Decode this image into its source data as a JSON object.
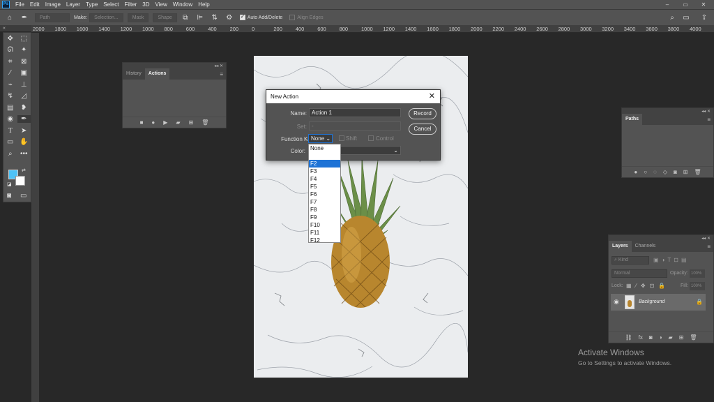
{
  "menubar": {
    "app_logo": "Ps",
    "items": [
      "File",
      "Edit",
      "Image",
      "Layer",
      "Type",
      "Select",
      "Filter",
      "3D",
      "View",
      "Window",
      "Help"
    ],
    "window_controls": [
      "–",
      "▭",
      "✕"
    ]
  },
  "options_bar": {
    "mode_value": "Path",
    "make_label": "Make:",
    "selection_button": "Selection...",
    "mask_button": "Mask",
    "shape_button": "Shape",
    "auto_add_delete_label": "Auto Add/Delete",
    "auto_add_delete_checked": true,
    "align_edges_label": "Align Edges",
    "align_edges_checked": false
  },
  "ruler": {
    "ticks": [
      "2000",
      "1800",
      "1600",
      "1400",
      "1200",
      "1000",
      "800",
      "600",
      "400",
      "200",
      "0",
      "200",
      "400",
      "600",
      "800",
      "1000",
      "1200",
      "1400",
      "1600",
      "1800",
      "2000",
      "2200",
      "2400",
      "2600",
      "2800",
      "3000",
      "3200",
      "3400",
      "3600",
      "3800",
      "4000"
    ]
  },
  "tabstrip": {
    "collapse_glyph": "«"
  },
  "tools": {
    "icons": [
      "move-icon",
      "marquee-icon",
      "lasso-icon",
      "magic-wand-icon",
      "crop-icon",
      "frame-icon",
      "eyedropper-icon",
      "spot-heal-icon",
      "brush-icon",
      "stamp-icon",
      "history-brush-icon",
      "eraser-icon",
      "gradient-icon",
      "blur-icon",
      "dodge-icon",
      "pen-icon",
      "type-icon",
      "path-select-icon",
      "rectangle-icon",
      "hand-icon",
      "zoom-icon",
      "more-icon"
    ],
    "colors": {
      "foreground": "#4fc3f7",
      "background": "#ffffff"
    }
  },
  "history_panel": {
    "tabs": [
      "History",
      "Actions"
    ],
    "active_tab": "Actions"
  },
  "dialog": {
    "title": "New Action",
    "name_label": "Name:",
    "name_value": "Action 1",
    "set_label": "Set:",
    "set_value": "-",
    "function_key_label": "Function Key:",
    "function_key_value": "None",
    "shift_label": "Shift",
    "control_label": "Control",
    "color_label": "Color:",
    "record_button": "Record",
    "cancel_button": "Cancel"
  },
  "function_key_options": [
    "None",
    "",
    "F2",
    "F3",
    "F4",
    "F5",
    "F6",
    "F7",
    "F8",
    "F9",
    "F10",
    "F11",
    "F12"
  ],
  "function_key_highlighted": "F2",
  "paths_panel": {
    "tab": "Paths"
  },
  "layers_panel": {
    "tabs": [
      "Layers",
      "Channels"
    ],
    "active_tab": "Layers",
    "filter_placeholder": "Kind",
    "blend_mode": "Normal",
    "opacity_label": "Opacity:",
    "opacity_value": "100%",
    "lock_label": "Lock:",
    "fill_label": "Fill:",
    "fill_value": "100%",
    "layers": [
      {
        "name": "Background",
        "visible": true,
        "locked": true
      }
    ]
  },
  "watermark": {
    "title": "Activate Windows",
    "subtitle": "Go to Settings to activate Windows."
  }
}
